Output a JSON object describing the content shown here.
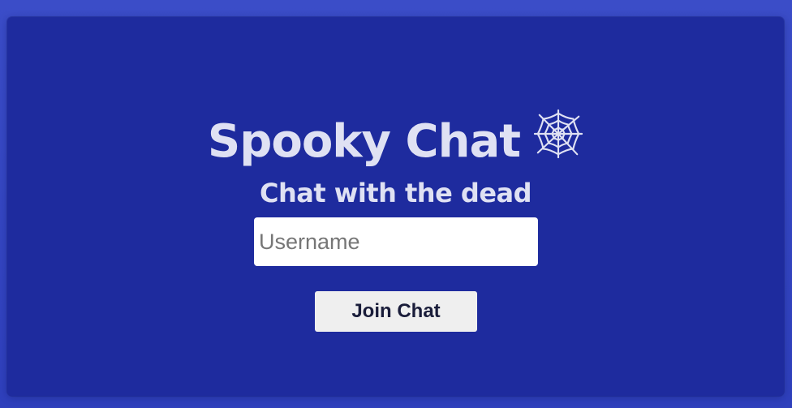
{
  "app": {
    "title": "Spooky Chat",
    "title_icon": "spider-web-icon",
    "subtitle": "Chat with the dead"
  },
  "form": {
    "username_placeholder": "Username",
    "username_value": "",
    "join_label": "Join Chat"
  },
  "colors": {
    "page_background": "#3c4fc4",
    "card_background": "#1e2b9e",
    "text": "#dfe1f3",
    "button_background": "#efefef",
    "button_text": "#1a1d3a"
  }
}
